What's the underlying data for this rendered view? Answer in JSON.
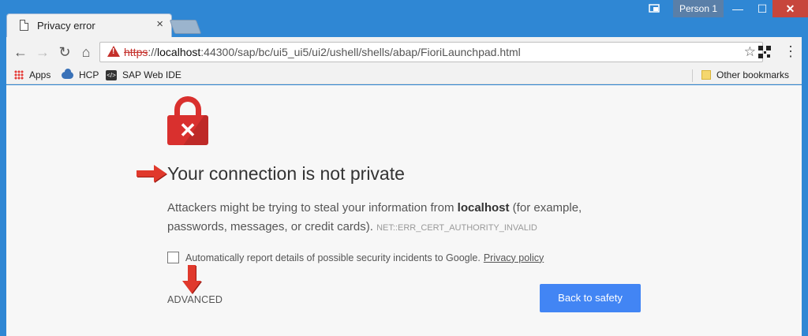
{
  "tab": {
    "title": "Privacy error",
    "close": "×"
  },
  "window": {
    "profile": "Person 1",
    "minimize": "—",
    "maximize": "☐",
    "close": "✕"
  },
  "toolbar": {
    "back": "←",
    "forward": "→",
    "reload": "↻",
    "home": "⌂",
    "url_scheme": "https",
    "url_sep": "://",
    "url_host": "localhost",
    "url_path": ":44300/sap/bc/ui5_ui5/ui2/ushell/shells/abap/FioriLaunchpad.html",
    "star": "☆",
    "menu": "⋮"
  },
  "bookmarks": {
    "items": [
      {
        "label": "Apps",
        "icon": "apps-grid-icon"
      },
      {
        "label": "HCP",
        "icon": "cloud-icon"
      },
      {
        "label": "SAP Web IDE",
        "icon": "web-ide-icon"
      }
    ],
    "other": "Other bookmarks"
  },
  "interstitial": {
    "lock_glyph": "✕",
    "heading": "Your connection is not private",
    "desc_before": "Attackers might be trying to steal your information from ",
    "desc_host": "localhost",
    "desc_after": " (for example, passwords, messages, or credit cards). ",
    "error_code": "NET::ERR_CERT_AUTHORITY_INVALID",
    "report_text": "Automatically report details of possible security incidents to Google.",
    "privacy_link": "Privacy policy",
    "advanced": "ADVANCED",
    "back_button": "Back to safety"
  },
  "colors": {
    "accent": "#4285f4",
    "error": "#d9302e",
    "annotation_arrow": "#d9302e"
  }
}
